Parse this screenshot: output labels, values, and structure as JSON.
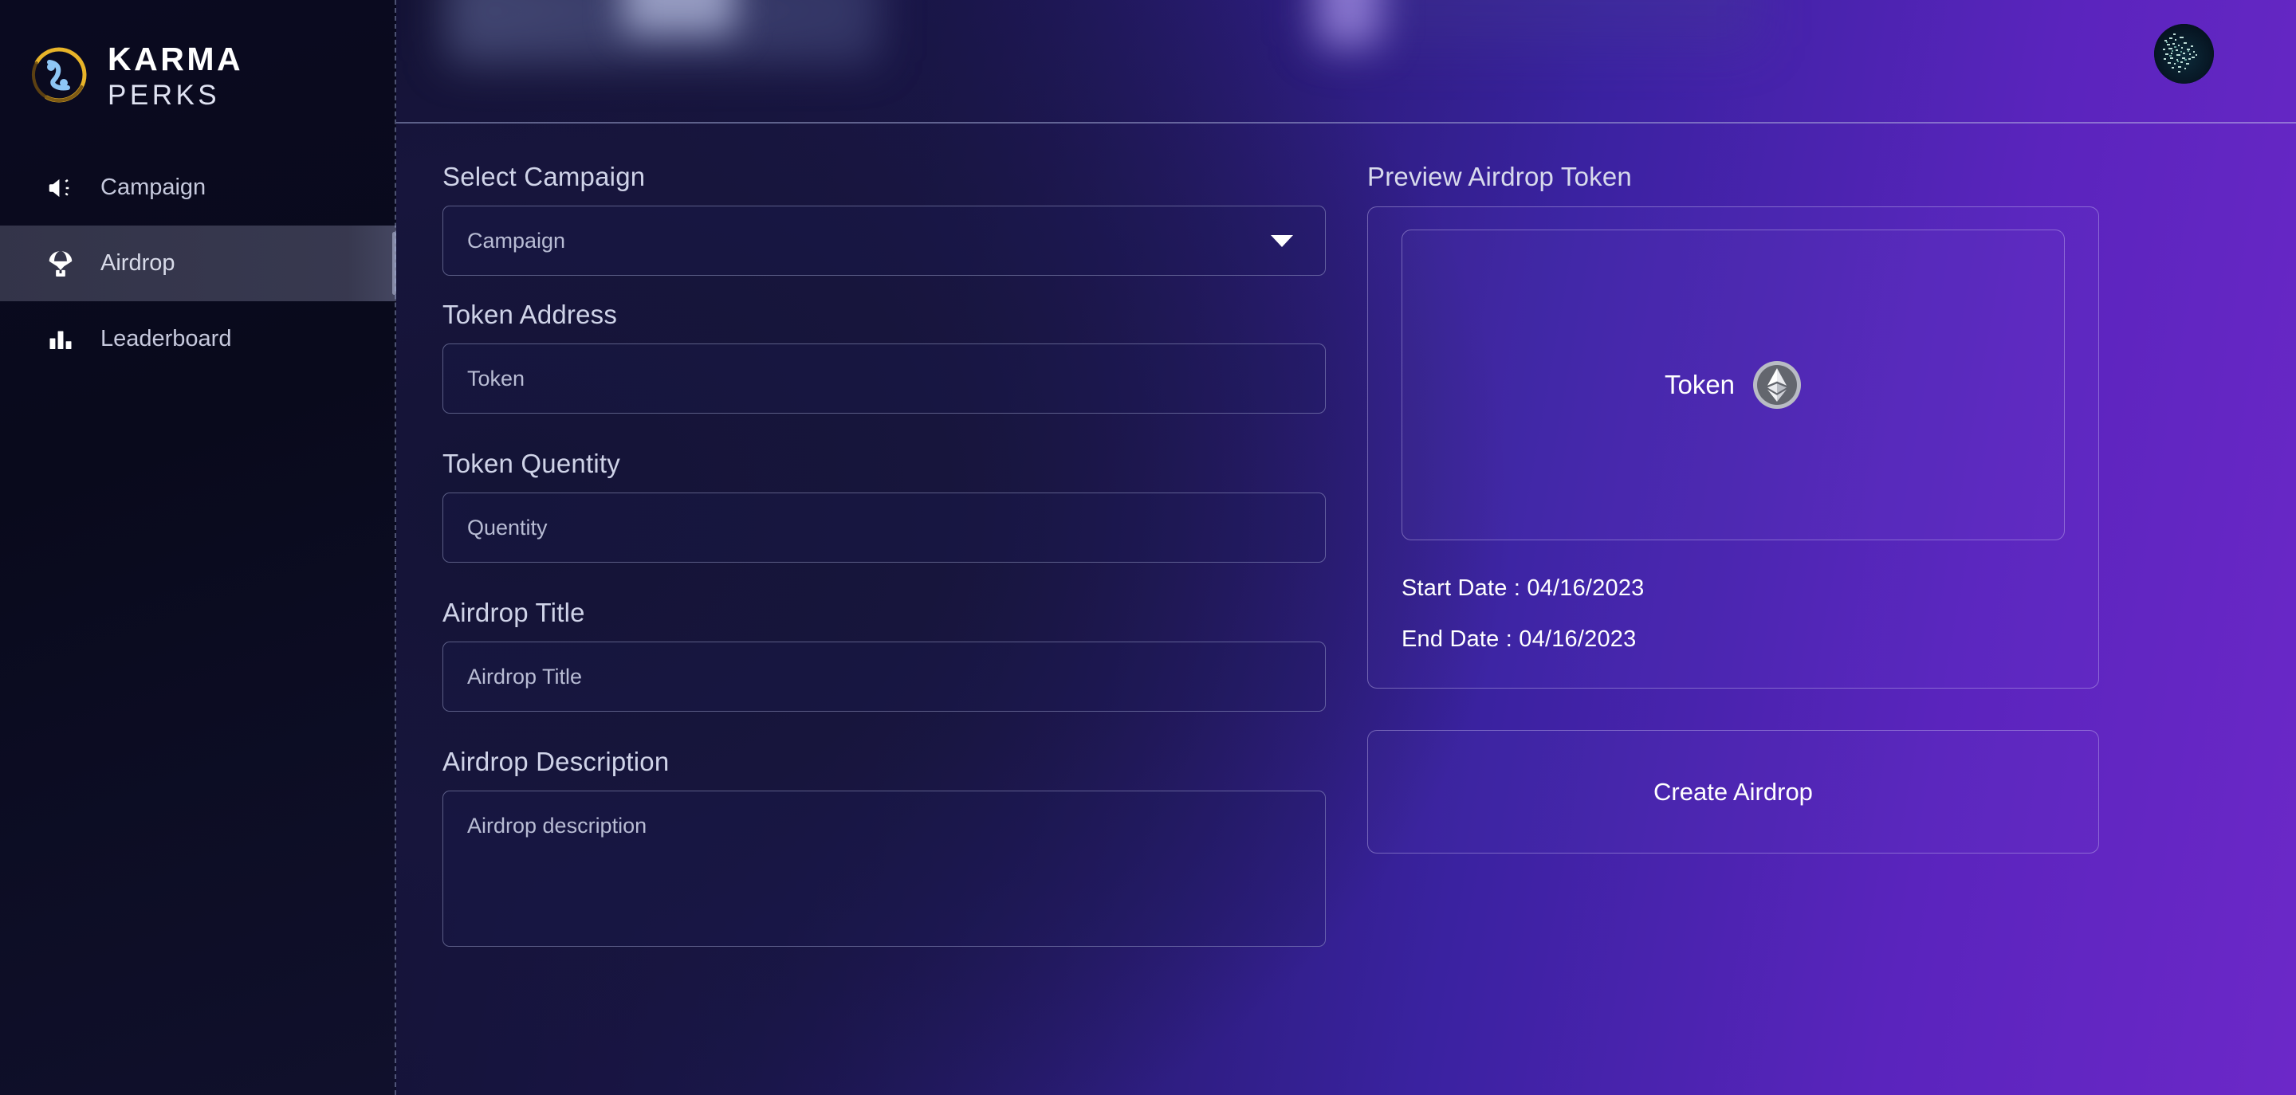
{
  "brand": {
    "logo_icon": "karma-yinyang-logo-icon",
    "title": "KARMA",
    "subtitle": "PERKS"
  },
  "sidebar": {
    "items": [
      {
        "id": "campaign",
        "label": "Campaign",
        "icon": "megaphone-icon",
        "active": false
      },
      {
        "id": "airdrop",
        "label": "Airdrop",
        "icon": "parachute-icon",
        "active": true
      },
      {
        "id": "leaderboard",
        "label": "Leaderboard",
        "icon": "bar-chart-icon",
        "active": false
      }
    ]
  },
  "header": {
    "avatar_icon": "user-avatar-noise-icon"
  },
  "form": {
    "select_campaign": {
      "label": "Select Campaign",
      "value": "Campaign",
      "caret_icon": "chevron-down-icon"
    },
    "token_address": {
      "label": "Token Address",
      "placeholder": "Token"
    },
    "token_quantity": {
      "label": "Token Quentity",
      "placeholder": "Quentity"
    },
    "airdrop_title": {
      "label": "Airdrop Title",
      "placeholder": "Airdrop Title"
    },
    "airdrop_description": {
      "label": "Airdrop Description",
      "placeholder": "Airdrop description"
    }
  },
  "preview": {
    "title": "Preview Airdrop Token",
    "token_label": "Token",
    "token_icon": "ethereum-coin-icon",
    "start_date": "Start Date : 04/16/2023",
    "end_date": "End Date : 04/16/2023",
    "create_button": "Create Airdrop"
  },
  "colors": {
    "sidebar_bg": "#0a0a20",
    "main_purple": "#6c28c8",
    "main_deep_blue": "#17153c",
    "accent_gold": "#e8b429",
    "accent_blue": "#8ec6f5",
    "text_primary": "#ffffff",
    "text_muted": "#b8bcd4",
    "border": "#b4bade"
  }
}
